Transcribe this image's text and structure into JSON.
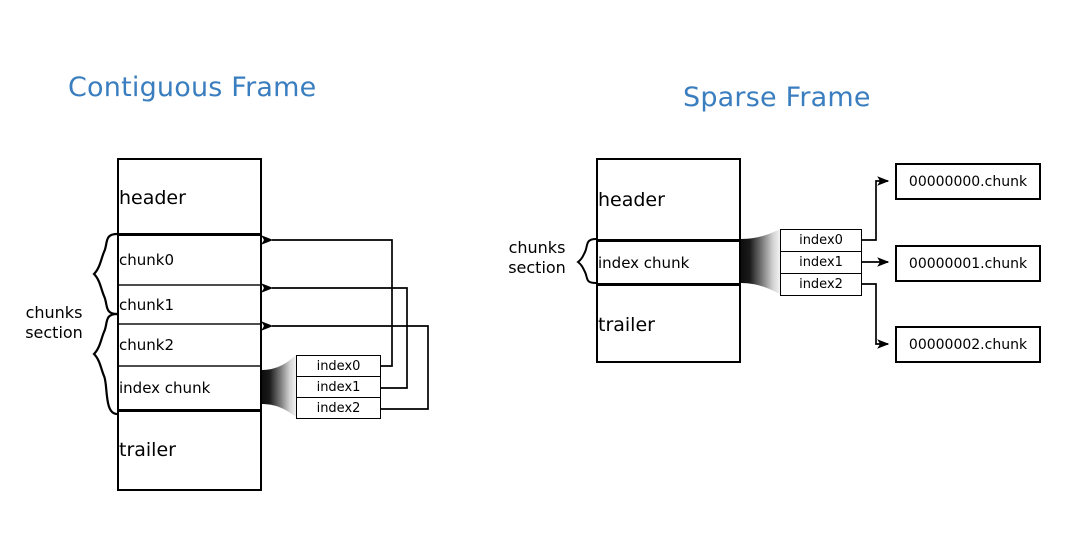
{
  "diagram": {
    "titles": {
      "contiguous": "Contiguous Frame",
      "sparse": "Sparse Frame"
    },
    "accent_color": "#3a7ebf",
    "line_color": "#000000",
    "background": "#ffffff",
    "contiguous": {
      "section_label": "chunks\nsection",
      "section_label_line1": "chunks",
      "section_label_line2": "section",
      "rows": [
        {
          "label": "header"
        },
        {
          "label": "chunk0"
        },
        {
          "label": "chunk1"
        },
        {
          "label": "chunk2"
        },
        {
          "label": "index chunk"
        },
        {
          "label": "trailer"
        }
      ],
      "index_entries": [
        {
          "label": "index0"
        },
        {
          "label": "index1"
        },
        {
          "label": "index2"
        }
      ]
    },
    "sparse": {
      "section_label_line1": "chunks",
      "section_label_line2": "section",
      "rows": [
        {
          "label": "header"
        },
        {
          "label": "index chunk"
        },
        {
          "label": "trailer"
        }
      ],
      "index_entries": [
        {
          "label": "index0"
        },
        {
          "label": "index1"
        },
        {
          "label": "index2"
        }
      ],
      "chunk_files": [
        {
          "label": "00000000.chunk"
        },
        {
          "label": "00000001.chunk"
        },
        {
          "label": "00000002.chunk"
        }
      ]
    }
  }
}
